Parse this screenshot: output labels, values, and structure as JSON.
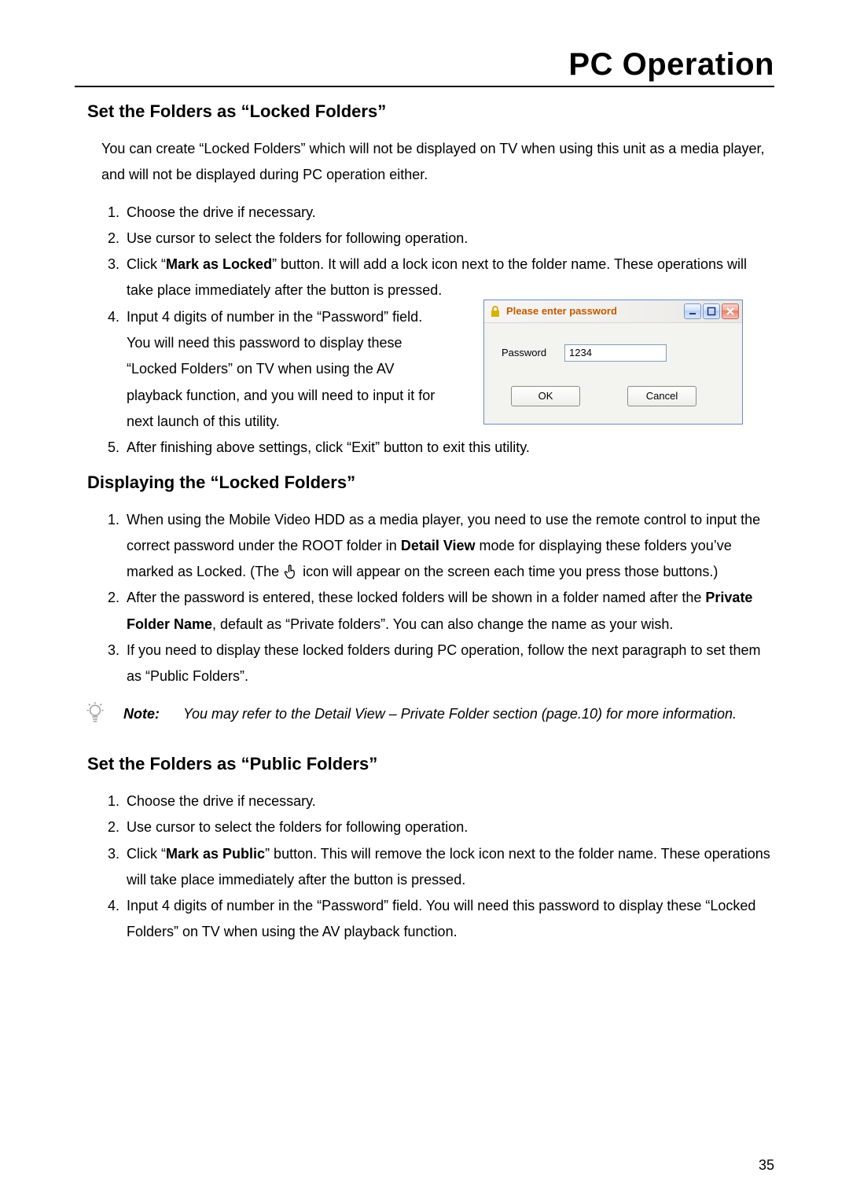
{
  "chapter_title": "PC Operation",
  "page_number": "35",
  "section_a": {
    "heading": "Set the Folders as “Locked Folders”",
    "intro": "You can create “Locked Folders” which will not be displayed on TV when using this unit as a media player, and will not be displayed during PC operation either.",
    "steps": {
      "s1": "Choose the drive if necessary.",
      "s2": "Use cursor to select the folders for following operation.",
      "s3_pre": "Click “",
      "s3_bold": "Mark as Locked",
      "s3_post": "” button. It will add a lock icon next to the folder name. These operations will take place immediately after the button is pressed.",
      "s4": "Input 4 digits of number in the “Password” field. You will need this password to display these “Locked Folders” on TV when using the AV playback function, and you will need to input it for next launch of this utility.",
      "s5": "After finishing above settings, click “Exit” button to exit this utility."
    }
  },
  "dialog": {
    "title": "Please enter password",
    "password_label": "Password",
    "password_value": "1234",
    "ok_label": "OK",
    "cancel_label": "Cancel"
  },
  "section_b": {
    "heading": "Displaying the “Locked Folders”",
    "steps": {
      "s1_pre": "When using the Mobile Video HDD as a media player, you need to use the remote control to input the correct password under the ROOT folder in ",
      "s1_bold": "Detail View",
      "s1_mid": " mode for displaying these folders you’ve marked as Locked. (The ",
      "s1_post": " icon will appear on the screen each time you press those buttons.)",
      "s2_pre": "After the password is entered, these locked folders will be shown in a folder named after the ",
      "s2_bold": "Private Folder Name",
      "s2_post": ", default as “Private folders”. You can also change the name as your wish.",
      "s3": "If you need to display these locked folders during PC operation, follow the next paragraph to set them as “Public Folders”."
    },
    "note_label": "Note:",
    "note_text": "You may refer to the Detail View – Private Folder section (page.10) for more information."
  },
  "section_c": {
    "heading": "Set the Folders as “Public Folders”",
    "steps": {
      "s1": "Choose the drive if necessary.",
      "s2": "Use cursor to select the folders for following operation.",
      "s3_pre": "Click “",
      "s3_bold": "Mark as Public",
      "s3_post": "” button. This will remove the lock icon next to the folder name. These operations will take place immediately after the button is pressed.",
      "s4": "Input 4 digits of number in the “Password” field. You will need this password to display these “Locked Folders” on TV when using the AV playback function."
    }
  }
}
